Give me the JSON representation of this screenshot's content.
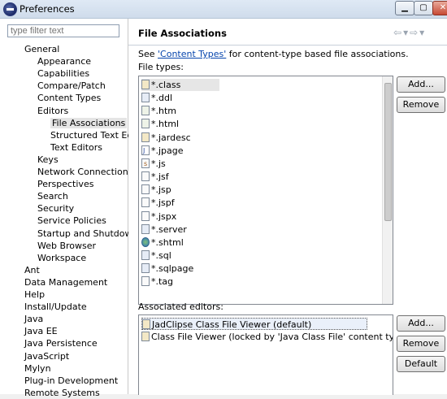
{
  "window": {
    "title": "Preferences"
  },
  "filter": {
    "placeholder": "type filter text"
  },
  "tree": [
    {
      "label": "General",
      "level": 1
    },
    {
      "label": "Appearance",
      "level": 2
    },
    {
      "label": "Capabilities",
      "level": 2
    },
    {
      "label": "Compare/Patch",
      "level": 2
    },
    {
      "label": "Content Types",
      "level": 2
    },
    {
      "label": "Editors",
      "level": 2
    },
    {
      "label": "File Associations",
      "level": 3,
      "selected": true
    },
    {
      "label": "Structured Text Edit",
      "level": 3
    },
    {
      "label": "Text Editors",
      "level": 3
    },
    {
      "label": "Keys",
      "level": 2
    },
    {
      "label": "Network Connections",
      "level": 2
    },
    {
      "label": "Perspectives",
      "level": 2
    },
    {
      "label": "Search",
      "level": 2
    },
    {
      "label": "Security",
      "level": 2
    },
    {
      "label": "Service Policies",
      "level": 2
    },
    {
      "label": "Startup and Shutdown",
      "level": 2
    },
    {
      "label": "Web Browser",
      "level": 2
    },
    {
      "label": "Workspace",
      "level": 2
    },
    {
      "label": "Ant",
      "level": 1
    },
    {
      "label": "Data Management",
      "level": 1
    },
    {
      "label": "Help",
      "level": 1
    },
    {
      "label": "Install/Update",
      "level": 1
    },
    {
      "label": "Java",
      "level": 1
    },
    {
      "label": "Java EE",
      "level": 1
    },
    {
      "label": "Java Persistence",
      "level": 1
    },
    {
      "label": "JavaScript",
      "level": 1
    },
    {
      "label": "Mylyn",
      "level": 1
    },
    {
      "label": "Plug-in Development",
      "level": 1
    },
    {
      "label": "Remote Systems",
      "level": 1
    }
  ],
  "main": {
    "title": "File Associations",
    "desc_prefix": "See ",
    "desc_link": "'Content Types'",
    "desc_suffix": " for content-type based file associations.",
    "file_types_label": "File types:",
    "file_types": [
      {
        "name": "*.class",
        "icon": "class-file-icon",
        "selected": true
      },
      {
        "name": "*.ddl",
        "icon": "sql-file-icon"
      },
      {
        "name": "*.htm",
        "icon": "html-file-icon"
      },
      {
        "name": "*.html",
        "icon": "html-file-icon"
      },
      {
        "name": "*.jardesc",
        "icon": "jar-file-icon"
      },
      {
        "name": "*.jpage",
        "icon": "java-file-icon"
      },
      {
        "name": "*.js",
        "icon": "js-file-icon"
      },
      {
        "name": "*.jsf",
        "icon": "file-icon"
      },
      {
        "name": "*.jsp",
        "icon": "file-icon"
      },
      {
        "name": "*.jspf",
        "icon": "file-icon"
      },
      {
        "name": "*.jspx",
        "icon": "file-icon"
      },
      {
        "name": "*.server",
        "icon": "server-file-icon"
      },
      {
        "name": "*.shtml",
        "icon": "globe-icon"
      },
      {
        "name": "*.sql",
        "icon": "sql-file-icon"
      },
      {
        "name": "*.sqlpage",
        "icon": "sql-file-icon"
      },
      {
        "name": "*.tag",
        "icon": "file-icon"
      }
    ],
    "add_label": "Add...",
    "remove_label": "Remove",
    "editors_label": "Associated editors:",
    "editors": [
      {
        "name": "JadClipse Class File Viewer (default)",
        "icon": "class-viewer-icon",
        "selected": true
      },
      {
        "name": "Class File Viewer (locked by 'Java Class File' content type)",
        "icon": "class-viewer-icon"
      }
    ],
    "editor_add_label": "Add...",
    "editor_remove_label": "Remove",
    "editor_default_label": "Default"
  }
}
